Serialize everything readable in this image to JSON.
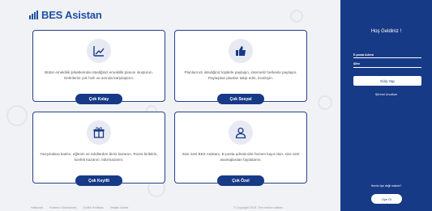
{
  "brand": {
    "name": "BES Asistan",
    "color": "#1d4fa3"
  },
  "cards": [
    {
      "icon": "chart-up-icon",
      "text": "Bütün emeklilik şirketlerinde istediğiniz emeklilik planını oluşturun. Getirilerini çok hızlı ve anında karşılaştırın.",
      "button": "Çok Kolay"
    },
    {
      "icon": "thumbs-up-icon",
      "text": "Planlarınızı istediğiniz kişilerle paylaşın, internetiz herkesle paylaşın. Paylaşılan planları takip edin, inceleyin.",
      "button": "Çok Sosyal"
    },
    {
      "icon": "gift-icon",
      "text": "Yarışmalara katılın, eğlenin ve ödüllerden birini kazanın. Rozet biriktirin, konfeti kazanın, ödül kazanın.",
      "button": "Çok Keyifli"
    },
    {
      "icon": "user-icon",
      "text": "Size özel BES Asistanı. E-posta adresinizle hemen kayıt olun, size özel avantajlardan faydalanın.",
      "button": "Çok Özel"
    }
  ],
  "footer": {
    "links": [
      "Hakkında",
      "Kullanıcı Sözleşmesi",
      "Gizlilik Politikası",
      "İletişim Adresi"
    ],
    "copyright": "© Copyright 2018. Tüm hakları saklıdır."
  },
  "login": {
    "welcome": "Hoş Geldiniz !",
    "email_label": "E-posta Adresi",
    "password_label": "Şifre",
    "login_button": "Giriş Yap",
    "forgot": "Şifremi Unuttum",
    "no_member": "Henüz üye değil misiniz?",
    "signup_button": "Üye Ol"
  },
  "colors": {
    "panel": "#173a86",
    "background": "#f1f2f6",
    "accent": "#173a86"
  }
}
